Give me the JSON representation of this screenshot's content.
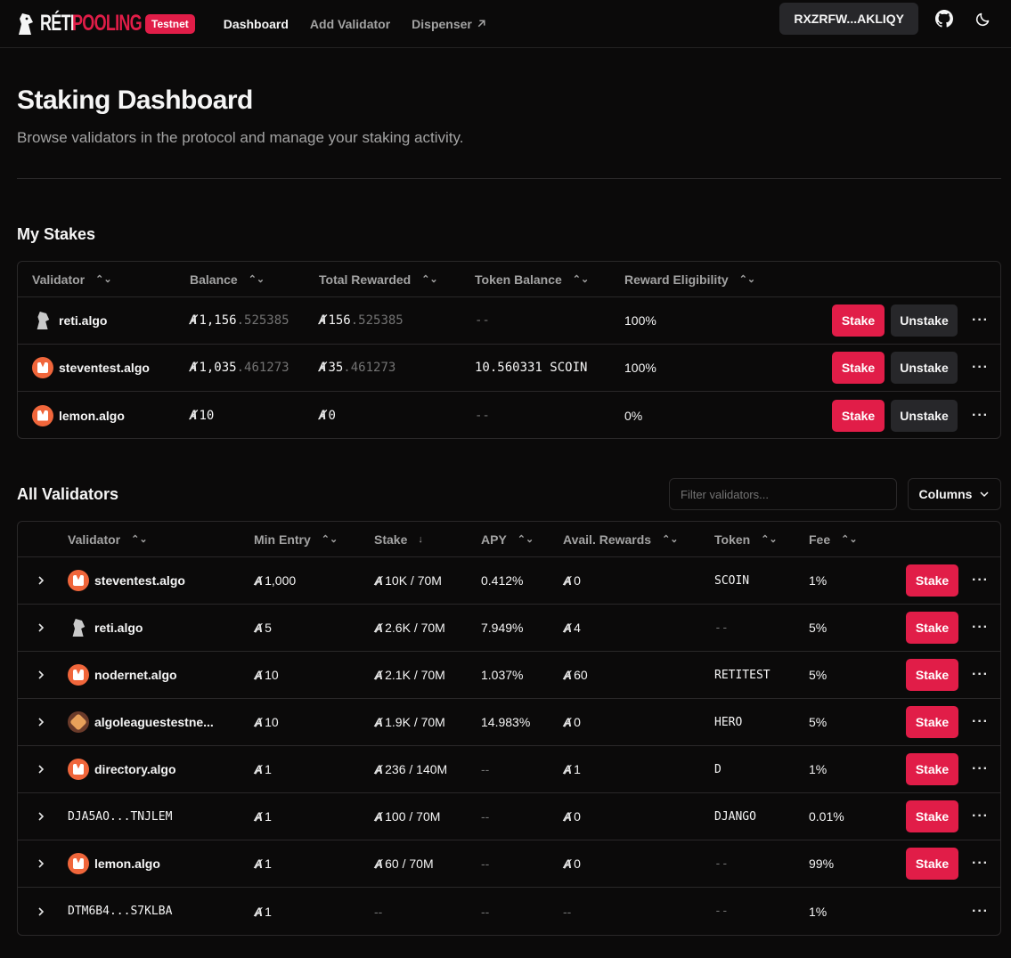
{
  "header": {
    "logo_reti": "RÉTI",
    "logo_pooling": "POOLING",
    "network_badge": "Testnet",
    "nav": [
      {
        "label": "Dashboard"
      },
      {
        "label": "Add Validator"
      },
      {
        "label": "Dispenser"
      }
    ],
    "wallet": "RXZRFW...AKLIQY",
    "github_icon": "github-icon",
    "theme_icon": "moon-icon"
  },
  "page": {
    "title": "Staking Dashboard",
    "subtitle": "Browse validators in the protocol and manage your staking activity."
  },
  "my_stakes": {
    "title": "My Stakes",
    "columns": [
      "Validator",
      "Balance",
      "Total Rewarded",
      "Token Balance",
      "Reward Eligibility"
    ],
    "rows": [
      {
        "validator": "reti.algo",
        "avatar": "knight",
        "balance_int": "1,156",
        "balance_dec": ".525385",
        "rewarded_int": "156",
        "rewarded_dec": ".525385",
        "token_balance": "--",
        "eligibility": "100%",
        "stake": "Stake",
        "unstake": "Unstake"
      },
      {
        "validator": "steventest.algo",
        "avatar": "orange",
        "balance_int": "1,035",
        "balance_dec": ".461273",
        "rewarded_int": "35",
        "rewarded_dec": ".461273",
        "token_balance": "10.560331 SCOIN",
        "eligibility": "100%",
        "stake": "Stake",
        "unstake": "Unstake"
      },
      {
        "validator": "lemon.algo",
        "avatar": "orange",
        "balance_int": "10",
        "balance_dec": "",
        "rewarded_int": "0",
        "rewarded_dec": "",
        "token_balance": "--",
        "eligibility": "0%",
        "stake": "Stake",
        "unstake": "Unstake"
      }
    ]
  },
  "all_validators": {
    "title": "All Validators",
    "filter_placeholder": "Filter validators...",
    "columns_button": "Columns",
    "columns": [
      "Validator",
      "Min Entry",
      "Stake",
      "APY",
      "Avail. Rewards",
      "Token",
      "Fee"
    ],
    "rows": [
      {
        "validator": "steventest.algo",
        "avatar": "orange",
        "mono": false,
        "min_entry": "1,000",
        "stake": "10K / 70M",
        "apy": "0.412%",
        "rewards": "0",
        "token": "SCOIN",
        "fee": "1%",
        "stake_btn": "Stake"
      },
      {
        "validator": "reti.algo",
        "avatar": "knight",
        "mono": false,
        "min_entry": "5",
        "stake": "2.6K / 70M",
        "apy": "7.949%",
        "rewards": "4",
        "token": "--",
        "fee": "5%",
        "stake_btn": "Stake"
      },
      {
        "validator": "nodernet.algo",
        "avatar": "orange",
        "mono": false,
        "min_entry": "10",
        "stake": "2.1K / 70M",
        "apy": "1.037%",
        "rewards": "60",
        "token": "RETITEST",
        "fee": "5%",
        "stake_btn": "Stake"
      },
      {
        "validator": "algoleaguestestne...",
        "avatar": "hero",
        "mono": false,
        "min_entry": "10",
        "stake": "1.9K / 70M",
        "apy": "14.983%",
        "rewards": "0",
        "token": "HERO",
        "fee": "5%",
        "stake_btn": "Stake"
      },
      {
        "validator": "directory.algo",
        "avatar": "orange",
        "mono": false,
        "min_entry": "1",
        "stake": "236 / 140M",
        "apy": "--",
        "rewards": "1",
        "token": "D",
        "fee": "1%",
        "stake_btn": "Stake"
      },
      {
        "validator": "DJA5AO...TNJLEM",
        "avatar": "none",
        "mono": true,
        "min_entry": "1",
        "stake": "100 / 70M",
        "apy": "--",
        "rewards": "0",
        "token": "DJANGO",
        "fee": "0.01%",
        "stake_btn": "Stake"
      },
      {
        "validator": "lemon.algo",
        "avatar": "orange",
        "mono": false,
        "min_entry": "1",
        "stake": "60 / 70M",
        "apy": "--",
        "rewards": "0",
        "token": "--",
        "fee": "99%",
        "stake_btn": "Stake"
      },
      {
        "validator": "DTM6B4...S7KLBA",
        "avatar": "none",
        "mono": true,
        "min_entry": "1",
        "stake": "--",
        "apy": "--",
        "rewards": "--",
        "token": "--",
        "fee": "1%",
        "stake_btn": ""
      }
    ]
  },
  "colors": {
    "accent": "#e11d48",
    "background": "#0b0a0a",
    "border": "#2a2829",
    "muted": "#a3a3a3",
    "avatar_orange": "#f0663b"
  }
}
